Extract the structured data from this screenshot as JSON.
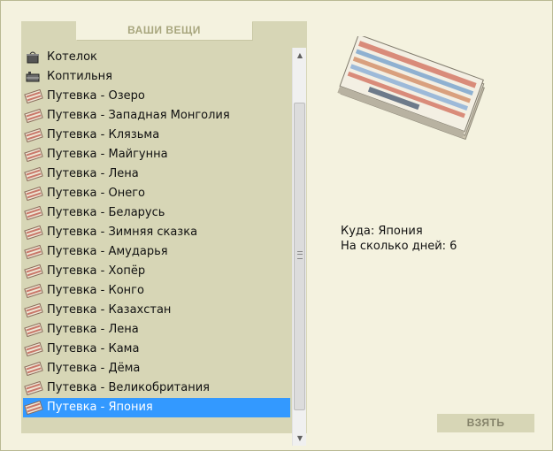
{
  "panel_title": "ВАШИ ВЕЩИ",
  "items": [
    {
      "label": "Котелок",
      "icon": "pot-icon"
    },
    {
      "label": "Коптильня",
      "icon": "smoker-icon"
    },
    {
      "label": "Путевка - Озеро",
      "icon": "ticket-icon"
    },
    {
      "label": "Путевка - Западная Монголия",
      "icon": "ticket-icon"
    },
    {
      "label": "Путевка - Клязьма",
      "icon": "ticket-icon"
    },
    {
      "label": "Путевка - Майгунна",
      "icon": "ticket-icon"
    },
    {
      "label": "Путевка - Лена",
      "icon": "ticket-icon"
    },
    {
      "label": "Путевка - Онего",
      "icon": "ticket-icon"
    },
    {
      "label": "Путевка - Беларусь",
      "icon": "ticket-icon"
    },
    {
      "label": "Путевка - Зимняя сказка",
      "icon": "ticket-icon"
    },
    {
      "label": "Путевка - Амударья",
      "icon": "ticket-icon"
    },
    {
      "label": "Путевка - Хопёр",
      "icon": "ticket-icon"
    },
    {
      "label": "Путевка - Конго",
      "icon": "ticket-icon"
    },
    {
      "label": "Путевка - Казахстан",
      "icon": "ticket-icon"
    },
    {
      "label": "Путевка - Лена",
      "icon": "ticket-icon"
    },
    {
      "label": "Путевка - Кама",
      "icon": "ticket-icon"
    },
    {
      "label": "Путевка - Дёма",
      "icon": "ticket-icon"
    },
    {
      "label": "Путевка - Великобритания",
      "icon": "ticket-icon"
    },
    {
      "label": "Путевка - Япония",
      "icon": "ticket-icon",
      "selected": true
    }
  ],
  "details": {
    "destination": "Куда: Япония",
    "days": "На сколько дней: 6"
  },
  "take_button": "ВЗЯТЬ",
  "colors": {
    "background": "#f4f2df",
    "panel": "#d7d6b6",
    "selection": "#3399ff",
    "title_text": "#a8a67e"
  }
}
